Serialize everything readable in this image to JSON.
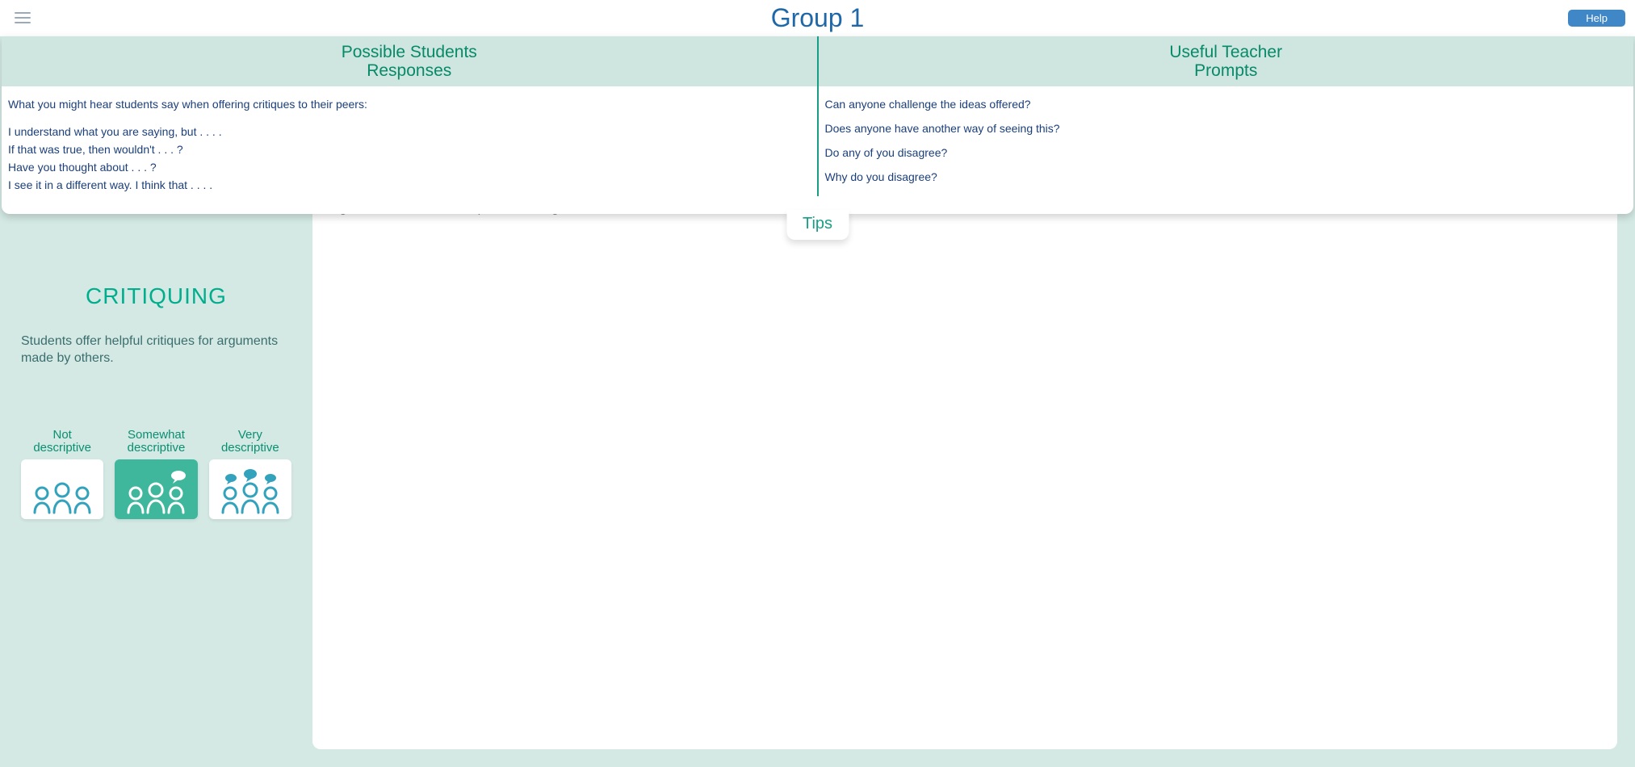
{
  "header": {
    "title": "Group 1",
    "help": "Help"
  },
  "tips": {
    "tab_label": "Tips",
    "left": {
      "heading_line1": "Possible Students",
      "heading_line2": "Responses",
      "intro": "What you might hear students say when offering critiques to their peers:",
      "lines": [
        "I understand what you are saying, but . . . .",
        "If that was true, then wouldn't . . . ?",
        "Have you thought about . . . ?",
        "I see it in a different way. I think that . . . ."
      ]
    },
    "right": {
      "heading_line1": "Useful Teacher",
      "heading_line2": "Prompts",
      "lines": [
        "Can anyone challenge the ideas offered?",
        "Does anyone have another way of seeing this?",
        "Do any of you disagree?",
        "Why do you disagree?"
      ]
    }
  },
  "sidebar": {
    "title": "CRITIQUING",
    "description": "Students offer helpful critiques for arguments made by others.",
    "options": [
      {
        "label_line1": "Not",
        "label_line2": "descriptive",
        "selected": false
      },
      {
        "label_line1": "Somewhat",
        "label_line2": "descriptive",
        "selected": true
      },
      {
        "label_line1": "Very",
        "label_line2": "descriptive",
        "selected": false
      }
    ]
  },
  "main": {
    "hint": "Might the User Guide be helpful in deciding which RML to use?"
  }
}
